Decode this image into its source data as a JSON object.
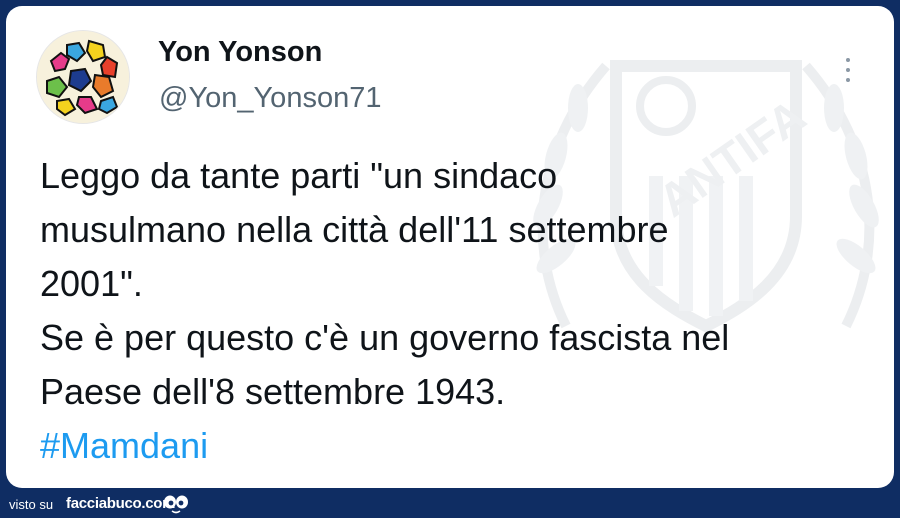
{
  "tweet": {
    "display_name": "Yon Yonson",
    "handle": "@Yon_Yonson71",
    "text_lines": [
      "Leggo da tante parti \"un sindaco",
      "musulmano nella città dell'11 settembre",
      "2001\".",
      "Se è per questo c'è un governo fascista nel",
      "Paese dell'8 settembre 1943."
    ],
    "hashtag": "#Mamdani",
    "avatar_icon": "keith-haring-figures-avatar",
    "more_icon": "more-options-icon",
    "watermark_text": "ANTIFA"
  },
  "footer": {
    "visto_su": "visto su",
    "brand": "facciabuco.com",
    "logo_icon": "facciabuco-logo-icon"
  },
  "colors": {
    "background": "#0f2d63",
    "card": "#ffffff",
    "text": "#0f1419",
    "secondary": "#536471",
    "hashtag": "#1d9bf0"
  }
}
